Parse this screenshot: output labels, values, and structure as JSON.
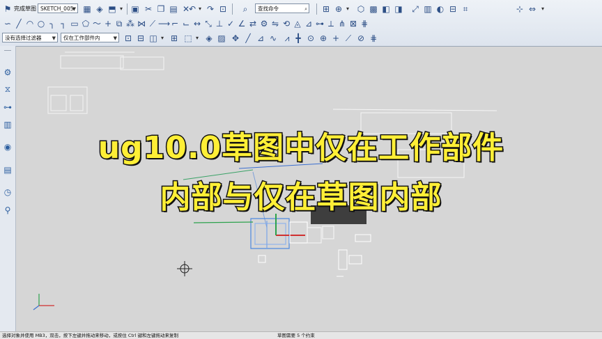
{
  "toolbar": {
    "finish_sketch_label": "完成草图",
    "sketch_name": "SKETCH_005",
    "command_finder_placeholder": "查找命令",
    "selection_filter": "没有选择过滤器",
    "selection_scope": "仅在工作部件内"
  },
  "overlay": {
    "line1": "ug10.0草图中仅在工作部件",
    "line2": "内部与仅在草图内部"
  },
  "status": {
    "hint": "选择对象并使用 MB3，双击，按下左键并拖动来移动，或按住 Ctrl 键和左键拖动来复制",
    "constraint": "草图需要 5 个约束"
  },
  "icons": {
    "row1": [
      "finish-sketch-icon",
      "sketch-settings-icon",
      "view-sketch-icon",
      "reattach-icon",
      "separator",
      "save-icon",
      "copy-icon",
      "paste-icon",
      "delete-icon",
      "separator",
      "undo-icon",
      "redo-icon",
      "separator",
      "command-finder-icon"
    ],
    "row2": [
      "profile-icon",
      "line-icon",
      "arc-icon",
      "circle-icon",
      "fillet-icon",
      "chamfer-icon",
      "rectangle-icon",
      "polygon-icon",
      "studio-spline-icon",
      "point-icon",
      "offset-curve-icon",
      "pattern-curve-icon",
      "mirror-curve-icon",
      "trim-icon",
      "extend-icon",
      "corner-icon",
      "make-corner-icon",
      "rapid-dimension-icon",
      "geometric-constraints-icon",
      "show-constraints-icon",
      "auto-constrain-icon"
    ],
    "row3": [
      "selection-filter-icon",
      "snap-endpoint-icon",
      "snap-midpoint-icon",
      "snap-center-icon",
      "snap-quadrant-icon",
      "snap-intersection-icon",
      "snap-existing-point-icon",
      "snap-on-curve-icon"
    ]
  },
  "colors": {
    "title_fill": "#ffef36",
    "title_outline": "#111111",
    "toolbar_bg": "#e7ecf3",
    "graphics_bg": "#d6d6d6"
  }
}
